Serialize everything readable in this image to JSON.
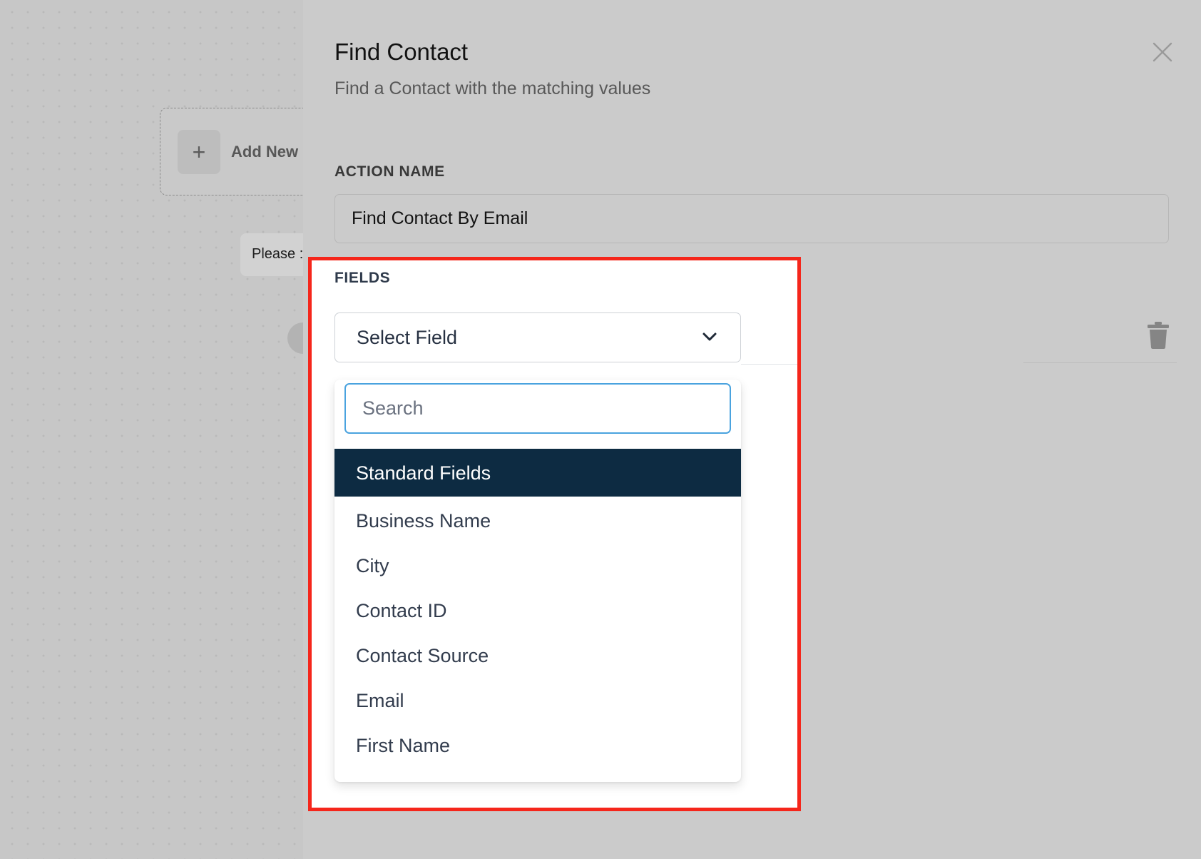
{
  "canvas": {
    "add_new_label": "Add New",
    "add_icon": "plus-icon",
    "hint_text": "Please :"
  },
  "drawer": {
    "title": "Find Contact",
    "subtitle": "Find a Contact with the matching values",
    "close_icon": "close-icon",
    "action_name_label": "ACTION NAME",
    "action_name_value": "Find Contact By Email",
    "fields_label": "FIELDS",
    "trash_icon": "trash-icon"
  },
  "field_select": {
    "selected": "Select Field",
    "chevron_icon": "chevron-down-icon",
    "search_placeholder": "Search",
    "group_header": "Standard Fields",
    "options": [
      "Business Name",
      "City",
      "Contact ID",
      "Contact Source",
      "Email",
      "First Name"
    ]
  },
  "colors": {
    "highlight_border": "#f5261b",
    "group_header_bg": "#0d2b42",
    "search_focus": "#4aa3df"
  }
}
